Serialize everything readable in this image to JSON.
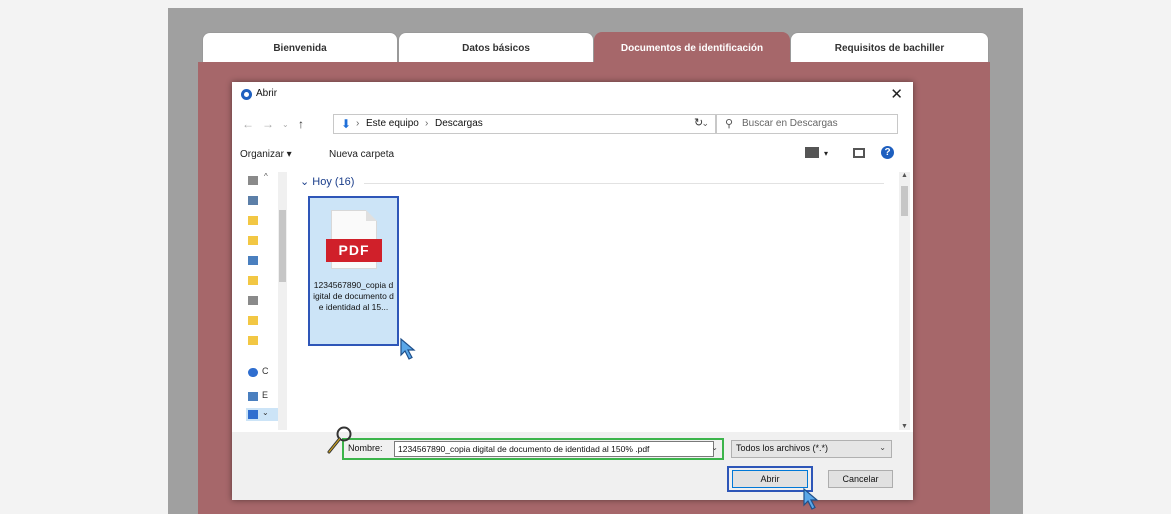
{
  "tabs": [
    {
      "label": "Bienvenida",
      "active": false
    },
    {
      "label": "Datos básicos",
      "active": false
    },
    {
      "label": "Documentos de identificación",
      "active": true
    },
    {
      "label": "Requisitos de bachiller",
      "active": false
    }
  ],
  "dialog": {
    "title": "Abrir",
    "close": "✕",
    "path": [
      "Este equipo",
      "Descargas"
    ],
    "search_placeholder": "Buscar en Descargas",
    "toolbar": {
      "organize": "Organizar ▾",
      "new_folder": "Nueva carpeta",
      "help": "?"
    },
    "group_label": "Hoy (16)",
    "file": {
      "type_label": "PDF",
      "name": "1234567890_copia digital de documento de identidad al 15..."
    },
    "name_label": "Nombre:",
    "name_value": "1234567890_copia digital de documento de identidad al 150% .pdf",
    "type_filter": "Todos los archivos (*.*)",
    "open_button": "Abrir",
    "cancel_button": "Cancelar"
  },
  "colors": {
    "panel": "#a6676a",
    "highlight_blue": "#2e56b8",
    "highlight_green": "#3cb44b",
    "pdf_red": "#d0202a"
  }
}
